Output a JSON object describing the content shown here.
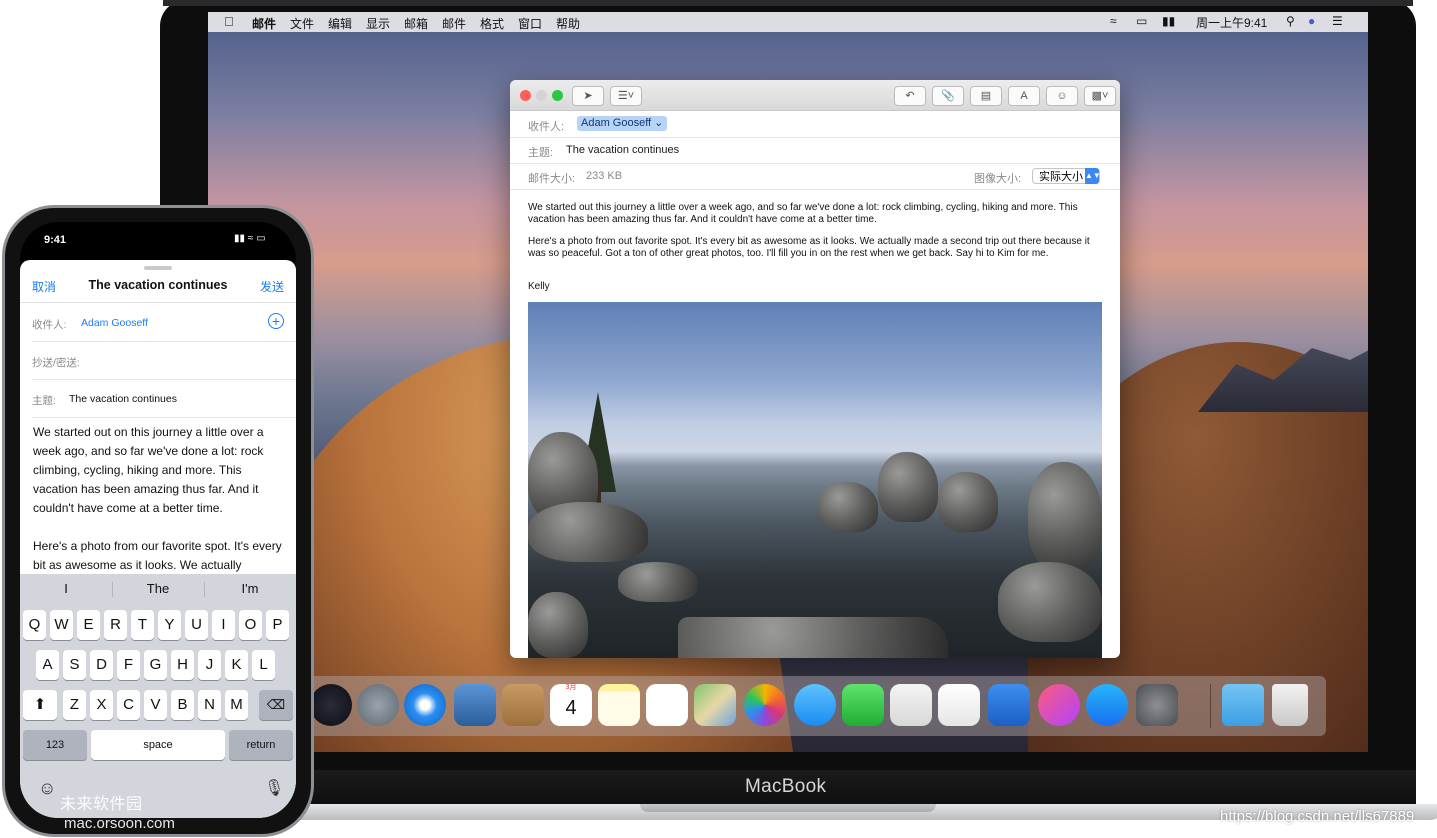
{
  "mac": {
    "brand": "MacBook",
    "menubar": {
      "items": [
        "邮件",
        "文件",
        "编辑",
        "显示",
        "邮箱",
        "邮件",
        "格式",
        "窗口",
        "帮助"
      ],
      "clock": "周一上午9:41"
    },
    "mail": {
      "to_label": "收件人:",
      "to_value": "Adam Gooseff ⌄",
      "subject_label": "主题:",
      "subject_value": "The vacation continues",
      "size_label": "邮件大小:",
      "size_value": "233 KB",
      "image_size_label": "图像大小:",
      "image_size_value": "实际大小",
      "paragraph1": "We started out this journey a little over a week ago, and so far we've done a lot: rock climbing, cycling, hiking and more. This vacation has been amazing thus far. And it couldn't have come at a better time.",
      "paragraph2": "Here's a photo from out favorite spot. It's every bit as awesome as it looks. We actually made a second trip out there because it was so peaceful. Got a ton of other great photos, too. I'll fill you in on the rest when we get back. Say hi to Kim for me.",
      "signature": "Kelly"
    },
    "dock_calendar": {
      "month": "3月",
      "day": "4"
    },
    "colors": {
      "accent": "#3d86f4",
      "close": "#fe5f57",
      "min": "#febc2e",
      "max": "#28c840"
    }
  },
  "phone": {
    "time": "9:41",
    "nav": {
      "cancel": "取消",
      "title": "The vacation continues",
      "send": "发送"
    },
    "to_label": "收件人:",
    "to_value": "Adam Gooseff",
    "cc_label": "抄送/密送:",
    "subject_label": "主题:",
    "subject_value": "The vacation continues",
    "paragraph1": "We started out on this journey a little over a week ago, and so far we've done a lot: rock climbing, cycling, hiking and more. This vacation has been amazing thus far. And it couldn't have come at a better time.",
    "paragraph2": "Here's a photo from our favorite spot. It's every bit as awesome as it looks. We actually",
    "suggestions": [
      "I",
      "The",
      "I'm"
    ],
    "keys": {
      "row1": [
        "Q",
        "W",
        "E",
        "R",
        "T",
        "Y",
        "U",
        "I",
        "O",
        "P"
      ],
      "row2": [
        "A",
        "S",
        "D",
        "F",
        "G",
        "H",
        "J",
        "K",
        "L"
      ],
      "row3": [
        "Z",
        "X",
        "C",
        "V",
        "B",
        "N",
        "M"
      ],
      "numbers": "123",
      "space": "space",
      "return": "return"
    }
  },
  "watermarks": {
    "site_cn": "未来软件园",
    "site": "mac.orsoon.com",
    "url": "https://blog.csdn.net/lls67889"
  }
}
